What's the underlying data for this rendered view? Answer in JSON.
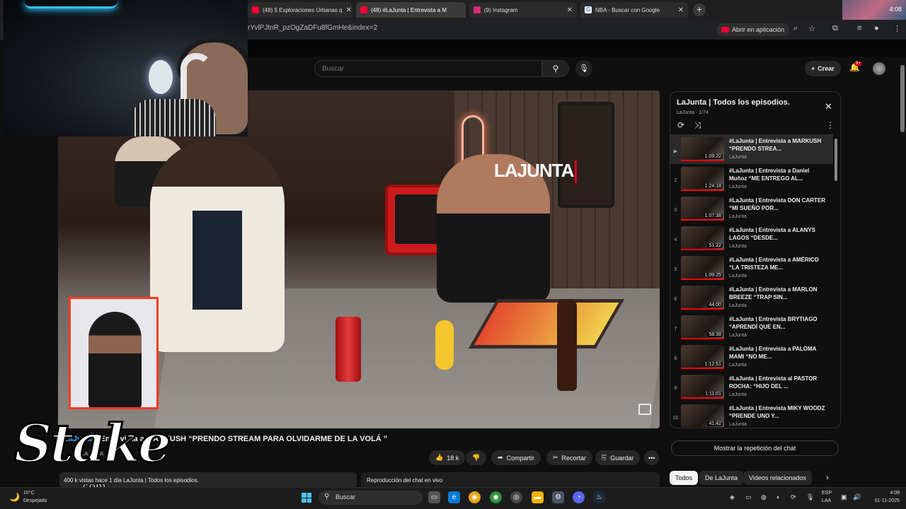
{
  "browser": {
    "tabs": [
      {
        "title": "(48) 5 Exploraciones Urbanas q",
        "favicon": "youtube-icon",
        "color": "#ff0033"
      },
      {
        "title": "(48) #LaJunta | Entrevista a M",
        "favicon": "youtube-icon",
        "color": "#ff0033"
      },
      {
        "title": "(9) Instagram",
        "favicon": "instagram-icon",
        "color": "#d62976"
      },
      {
        "title": "NBA - Buscar con Google",
        "favicon": "google-icon",
        "color": "#4285f4"
      }
    ],
    "url": "rYvlPJtnR_pzOgZaDFu8fGmHe&index=2",
    "open_in_app": "Abrir en aplicación",
    "clock_widget": "4:08"
  },
  "youtube": {
    "search_placeholder": "Buscar",
    "create_label": "Crear",
    "notifications_badge": "9+",
    "video": {
      "title_hash": "#LaJunta",
      "title_rest": " | Entrevista a MARKUSH “PRENDO STREAM PARA OLVIDARME DE LA VOLÁ ”",
      "channel": "LaJunta",
      "overlay_logo": "LAJUNTA",
      "likes": "18 k",
      "share": "Compartir",
      "clip": "Recortar",
      "save": "Guardar",
      "description": "400 k vistas  hace 1 día  LaJunta | Todos los episodios.",
      "chat_replay_header": "Reproducción del chat en vivo"
    },
    "playlist": {
      "title": "LaJunta | Todos los episodios.",
      "subtitle": "LaJunta - 1/74",
      "items": [
        {
          "index": "▶",
          "title": "#LaJunta | Entrevista a MARKUSH “PRENDO STREA...",
          "channel": "LaJunta",
          "duration": "1:09:22",
          "active": true
        },
        {
          "index": "2",
          "title": "#LaJunta | Entrevista a Daniel Muñoz “ME ENTREGO AL...",
          "channel": "LaJunta",
          "duration": "1:24:18"
        },
        {
          "index": "3",
          "title": "#LaJunta | Entrevista DON CARTER “MI SUEÑO POR...",
          "channel": "LaJunta",
          "duration": "1:07:38"
        },
        {
          "index": "4",
          "title": "#LaJunta | Entrevista a ALANYS LAGOS “DESDE...",
          "channel": "LaJunta",
          "duration": "51:22"
        },
        {
          "index": "5",
          "title": "#LaJunta | Entrevista a AMÉRICO “LA TRISTEZA ME...",
          "channel": "LaJunta",
          "duration": "1:09:25"
        },
        {
          "index": "6",
          "title": "#LaJunta | Entrevista a MARLON BREEZE “TRAP SIN...",
          "channel": "LaJunta",
          "duration": "44:00"
        },
        {
          "index": "7",
          "title": "#LaJunta | Entrevista BRYTIAGO “APRENDÍ QUE EN...",
          "channel": "LaJunta",
          "duration": "58:38"
        },
        {
          "index": "8",
          "title": "#LaJunta | Entrevista a PALOMA MAMI “NO ME...",
          "channel": "LaJunta",
          "duration": "1:12:51"
        },
        {
          "index": "9",
          "title": "#LaJunta | Entrevista al PASTOR ROCHA: “HIJO DEL ...",
          "channel": "LaJunta",
          "duration": "1:11:01"
        },
        {
          "index": "10",
          "title": "#LaJunta | Entrevista MIKY WOODZ “PRENDE UNO Y...",
          "channel": "LaJunta",
          "duration": "41:42"
        }
      ]
    },
    "show_chat_replay": "Mostrar la repetición del chat",
    "chips": [
      "Todos",
      "De LaJunta",
      "Videos relacionados"
    ]
  },
  "overlay": {
    "sponsor": "Stake",
    "sponsor_tld": ".com"
  },
  "taskbar": {
    "temperature": "10°C",
    "condition": "Despejado",
    "search": "Buscar",
    "lang": "ESP",
    "lang2": "LAA",
    "time": "4:08",
    "date": "01-11-2025"
  }
}
